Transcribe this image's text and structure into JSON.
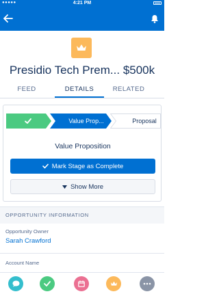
{
  "status_bar": {
    "carrier": "●●●●● ",
    "time": "4:21 PM"
  },
  "nav": {
    "back_icon": "arrow-left-icon",
    "notifications_icon": "bell-icon"
  },
  "record": {
    "icon": "crown-icon",
    "icon_color": "#fcb95b",
    "title": "Presidio Tech Prem... $500k"
  },
  "tabs": [
    {
      "label": "FEED",
      "active": false
    },
    {
      "label": "DETAILS",
      "active": true
    },
    {
      "label": "RELATED",
      "active": false
    }
  ],
  "path": {
    "stages": [
      {
        "label": "",
        "state": "complete",
        "color": "#4bca81"
      },
      {
        "label": "Value Prop...",
        "state": "current",
        "color": "#0070d2"
      },
      {
        "label": "Proposal",
        "state": "upcoming",
        "color": "#ffffff"
      }
    ],
    "current_stage_name": "Value Proposition",
    "mark_complete_label": "Mark Stage as Complete",
    "show_more_label": "Show More"
  },
  "section": {
    "title": "OPPORTUNITY  INFORMATION",
    "fields": [
      {
        "label": "Opportunity Owner",
        "value": "Sarah Crawford"
      },
      {
        "label": "Account Name",
        "value": ""
      }
    ]
  },
  "actions": [
    {
      "icon": "chat-bubble-icon",
      "color": "#34becd"
    },
    {
      "icon": "checkmark-icon",
      "color": "#4bca81"
    },
    {
      "icon": "calendar-icon",
      "color": "#eb7092"
    },
    {
      "icon": "crown-icon",
      "color": "#fcb95b"
    },
    {
      "icon": "more-icon",
      "color": "#8a94a6"
    }
  ]
}
